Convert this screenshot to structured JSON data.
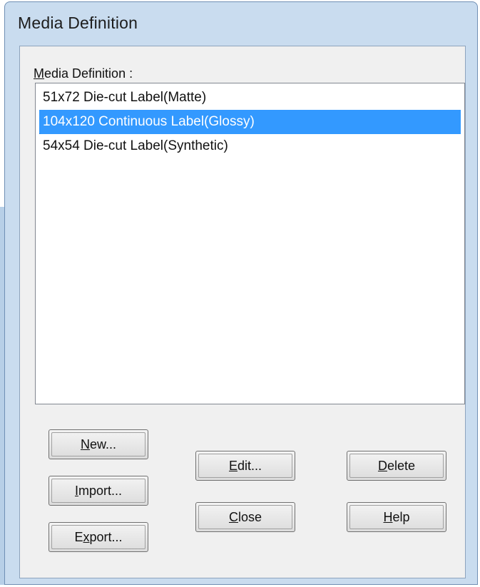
{
  "window": {
    "title": "Media Definition"
  },
  "list": {
    "label_prefix": "M",
    "label_rest": "edia Definition :",
    "items": [
      {
        "label": "51x72 Die-cut Label(Matte)",
        "selected": false
      },
      {
        "label": "104x120 Continuous Label(Glossy)",
        "selected": true
      },
      {
        "label": "54x54 Die-cut Label(Synthetic)",
        "selected": false
      }
    ]
  },
  "buttons": {
    "new": {
      "pre": "",
      "key": "N",
      "post": "ew..."
    },
    "import": {
      "pre": "",
      "key": "I",
      "post": "mport..."
    },
    "export": {
      "pre": "E",
      "key": "x",
      "post": "port..."
    },
    "edit": {
      "pre": "",
      "key": "E",
      "post": "dit..."
    },
    "close": {
      "pre": "",
      "key": "C",
      "post": "lose"
    },
    "delete": {
      "pre": "",
      "key": "D",
      "post": "elete"
    },
    "help": {
      "pre": "",
      "key": "H",
      "post": "elp"
    }
  },
  "colors": {
    "selection": "#3399ff",
    "highlight_ring": "#1a63b7",
    "frame": "#c9dcef"
  }
}
